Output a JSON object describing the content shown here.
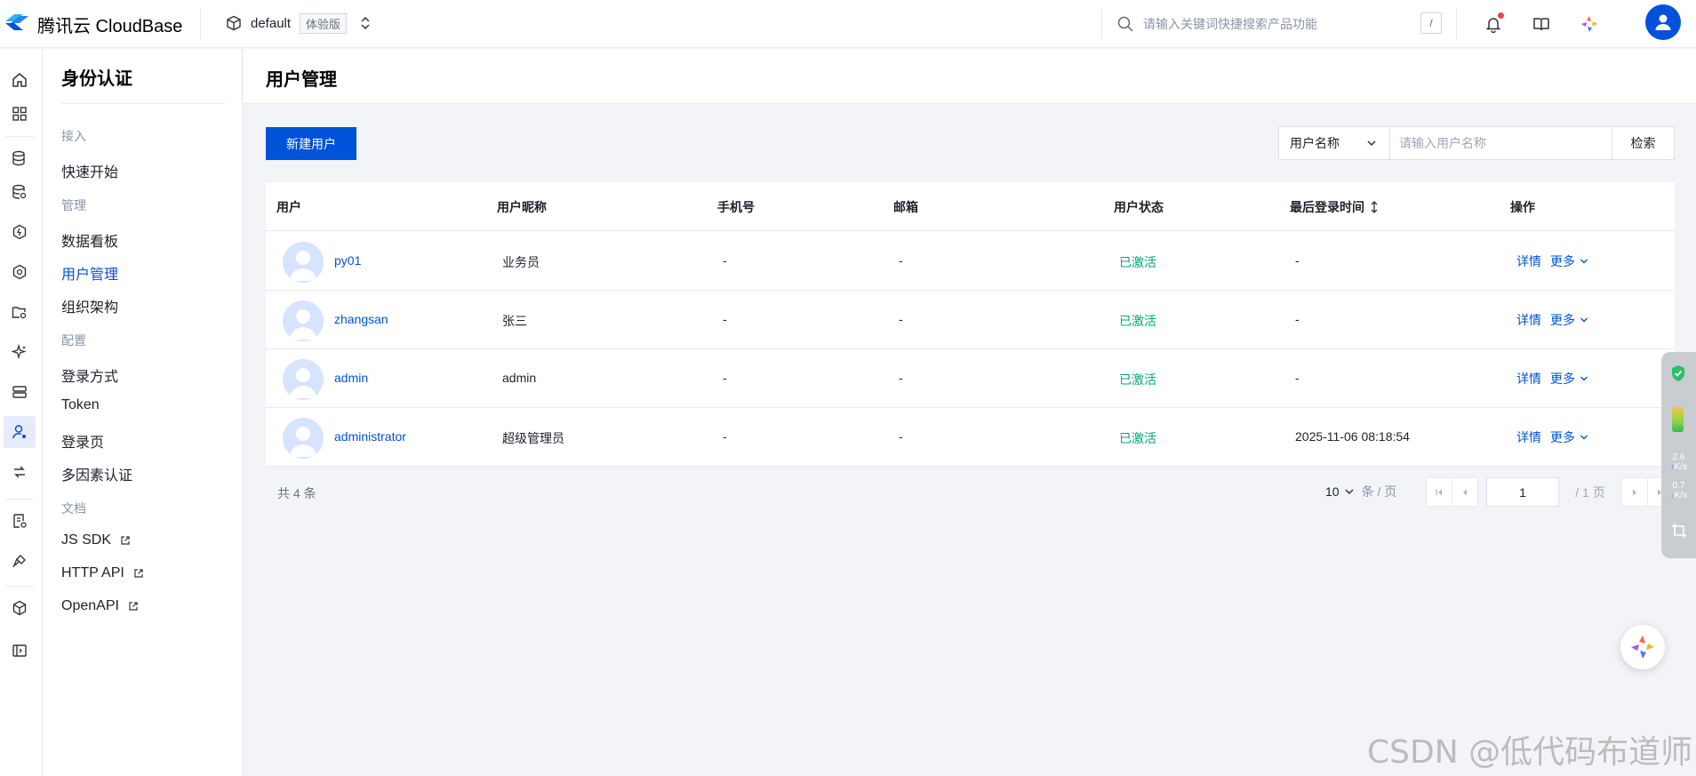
{
  "header": {
    "brand": "腾讯云 CloudBase",
    "env_name": "default",
    "env_tag": "体验版",
    "search_placeholder": "请输入关键词快捷搜索产品功能",
    "search_shortcut": "/"
  },
  "subnav": {
    "title": "身份认证",
    "groups": [
      {
        "label": "接入",
        "items": [
          {
            "label": "快速开始"
          }
        ]
      },
      {
        "label": "管理",
        "items": [
          {
            "label": "数据看板"
          },
          {
            "label": "用户管理"
          },
          {
            "label": "组织架构"
          }
        ]
      },
      {
        "label": "配置",
        "items": [
          {
            "label": "登录方式"
          },
          {
            "label": "Token"
          },
          {
            "label": "登录页"
          },
          {
            "label": "多因素认证"
          }
        ]
      },
      {
        "label": "文档",
        "items": [
          {
            "label": "JS SDK"
          },
          {
            "label": "HTTP API"
          },
          {
            "label": "OpenAPI"
          }
        ]
      }
    ],
    "active_item": "用户管理"
  },
  "page": {
    "title": "用户管理",
    "new_user_button": "新建用户",
    "filter_field": "用户名称",
    "filter_placeholder": "请输入用户名称",
    "search_button": "检索"
  },
  "table": {
    "columns": [
      "用户",
      "用户昵称",
      "手机号",
      "邮箱",
      "用户状态",
      "最后登录时间",
      "操作"
    ],
    "rows": [
      {
        "user": "py01",
        "nickname": "业务员",
        "phone": "-",
        "email": "-",
        "status": "已激活",
        "last_login": "-",
        "detail": "详情",
        "more": "更多"
      },
      {
        "user": "zhangsan",
        "nickname": "张三",
        "phone": "-",
        "email": "-",
        "status": "已激活",
        "last_login": "-",
        "detail": "详情",
        "more": "更多"
      },
      {
        "user": "admin",
        "nickname": "admin",
        "phone": "-",
        "email": "-",
        "status": "已激活",
        "last_login": "-",
        "detail": "详情",
        "more": "更多"
      },
      {
        "user": "administrator",
        "nickname": "超级管理员",
        "phone": "-",
        "email": "-",
        "status": "已激活",
        "last_login": "2025-11-06 08:18:54",
        "detail": "详情",
        "more": "更多"
      }
    ]
  },
  "pagination": {
    "total": "共 4 条",
    "page_size": "10",
    "page_size_unit": "条 / 页",
    "current_page": "1",
    "total_pages": "/ 1 页"
  },
  "float_panel": {
    "upload_rate": "2.6",
    "upload_unit": "K/s",
    "download_rate": "0.7",
    "download_unit": "K/s"
  },
  "watermark": "CSDN @低代码布道师",
  "colors": {
    "primary": "#0052d9",
    "status_active": "#00a870",
    "page_bg": "#f2f4f8"
  }
}
